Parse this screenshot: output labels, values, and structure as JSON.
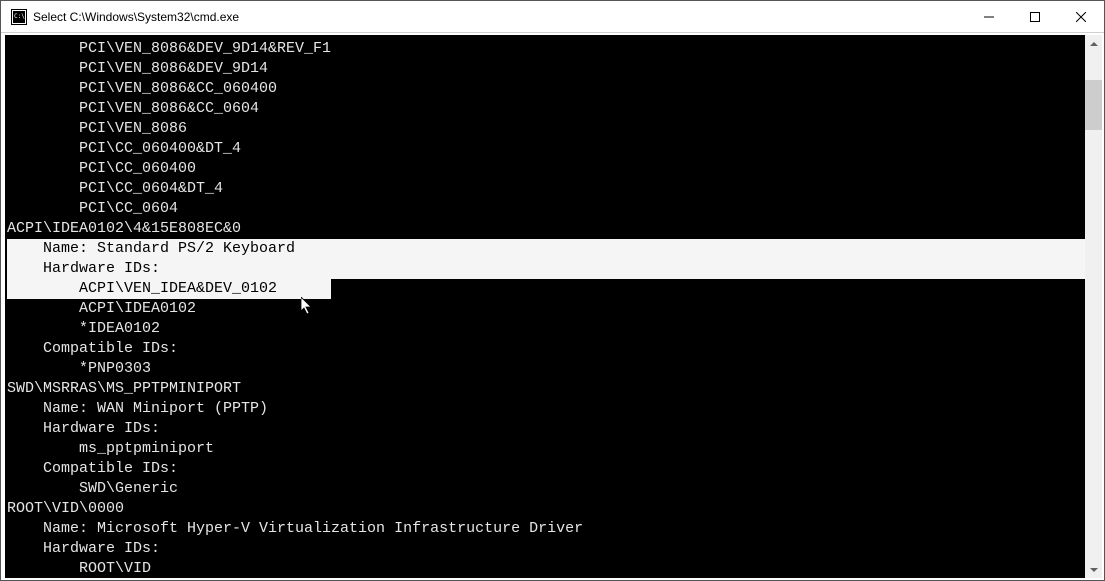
{
  "window": {
    "title": "Select C:\\Windows\\System32\\cmd.exe",
    "controls": {
      "minimize": "minimize",
      "maximize": "maximize",
      "close": "close"
    }
  },
  "console": {
    "lines": [
      {
        "indent": "        ",
        "text": "PCI\\VEN_8086&DEV_9D14&REV_F1",
        "selected": false
      },
      {
        "indent": "        ",
        "text": "PCI\\VEN_8086&DEV_9D14",
        "selected": false
      },
      {
        "indent": "        ",
        "text": "PCI\\VEN_8086&CC_060400",
        "selected": false
      },
      {
        "indent": "        ",
        "text": "PCI\\VEN_8086&CC_0604",
        "selected": false
      },
      {
        "indent": "        ",
        "text": "PCI\\VEN_8086",
        "selected": false
      },
      {
        "indent": "        ",
        "text": "PCI\\CC_060400&DT_4",
        "selected": false
      },
      {
        "indent": "        ",
        "text": "PCI\\CC_060400",
        "selected": false
      },
      {
        "indent": "        ",
        "text": "PCI\\CC_0604&DT_4",
        "selected": false
      },
      {
        "indent": "        ",
        "text": "PCI\\CC_0604",
        "selected": false
      },
      {
        "indent": "",
        "text": "ACPI\\IDEA0102\\4&15E808EC&0",
        "selected": false
      },
      {
        "indent": "    ",
        "text": "Name: Standard PS/2 Keyboard",
        "selected": true
      },
      {
        "indent": "    ",
        "text": "Hardware IDs:",
        "selected": true
      },
      {
        "indent": "        ",
        "text": "ACPI\\VEN_IDEA&DEV_0102",
        "selected": "partial",
        "sel_pad": "      "
      },
      {
        "indent": "        ",
        "text": "ACPI\\IDEA0102",
        "selected": false
      },
      {
        "indent": "        ",
        "text": "*IDEA0102",
        "selected": false
      },
      {
        "indent": "    ",
        "text": "Compatible IDs:",
        "selected": false
      },
      {
        "indent": "        ",
        "text": "*PNP0303",
        "selected": false
      },
      {
        "indent": "",
        "text": "SWD\\MSRRAS\\MS_PPTPMINIPORT",
        "selected": false
      },
      {
        "indent": "    ",
        "text": "Name: WAN Miniport (PPTP)",
        "selected": false
      },
      {
        "indent": "    ",
        "text": "Hardware IDs:",
        "selected": false
      },
      {
        "indent": "        ",
        "text": "ms_pptpminiport",
        "selected": false
      },
      {
        "indent": "    ",
        "text": "Compatible IDs:",
        "selected": false
      },
      {
        "indent": "        ",
        "text": "SWD\\Generic",
        "selected": false
      },
      {
        "indent": "",
        "text": "ROOT\\VID\\0000",
        "selected": false
      },
      {
        "indent": "    ",
        "text": "Name: Microsoft Hyper-V Virtualization Infrastructure Driver",
        "selected": false
      },
      {
        "indent": "    ",
        "text": "Hardware IDs:",
        "selected": false
      },
      {
        "indent": "        ",
        "text": "ROOT\\VID",
        "selected": false
      }
    ]
  },
  "icons": {
    "cmd": "cmd-icon",
    "scroll_up": "▲",
    "scroll_down": "▼"
  }
}
